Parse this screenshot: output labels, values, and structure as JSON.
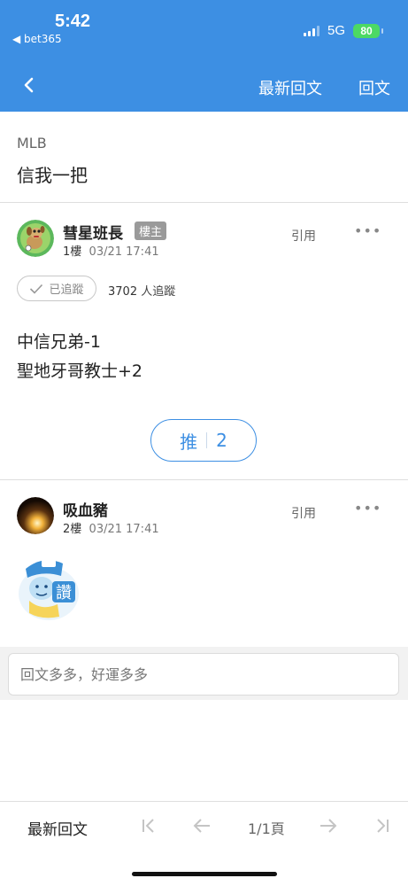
{
  "status_bar": {
    "time": "5:42",
    "back_app": "◀ bet365",
    "network": "5G",
    "battery": "80"
  },
  "nav": {
    "latest_reply": "最新回文",
    "reply": "回文"
  },
  "thread": {
    "board": "MLB",
    "title": "信我一把"
  },
  "posts": [
    {
      "author": "彗星班長",
      "badge": "樓主",
      "floor": "1樓",
      "time": "03/21 17:41",
      "quote": "引用",
      "more": "•••",
      "follow_label": "已追蹤",
      "follow_count": "3702",
      "follow_suffix": "人追蹤",
      "content_line1": "中信兄弟-1",
      "content_line2": "聖地牙哥教士+2",
      "push_label": "推",
      "push_count": "2"
    },
    {
      "author": "吸血豬",
      "floor": "2樓",
      "time": "03/21 17:41",
      "quote": "引用",
      "more": "•••",
      "sticker_text": "讚"
    }
  ],
  "reply_box": {
    "placeholder": "回文多多，好運多多"
  },
  "footer": {
    "latest_reply": "最新回文",
    "page_info": "1/1頁"
  },
  "colors": {
    "header_bg": "#3d8fe3",
    "accent": "#3d8fe3",
    "battery": "#4cd964"
  },
  "icons": [
    "back-chevron-icon",
    "check-icon",
    "more-icon",
    "first-page-icon",
    "prev-page-icon",
    "next-page-icon",
    "last-page-icon"
  ]
}
